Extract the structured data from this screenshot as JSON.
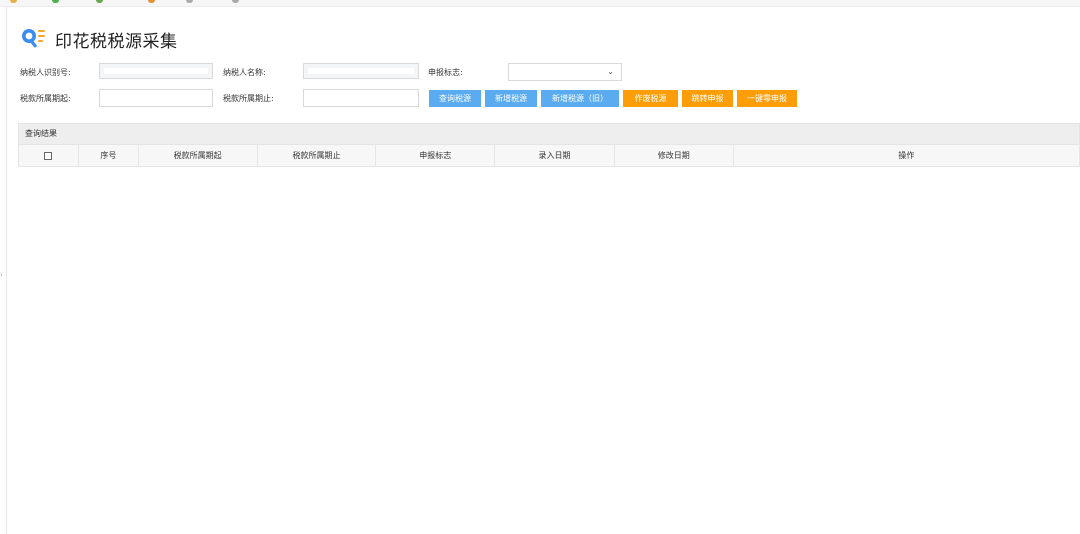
{
  "page": {
    "title": "印花税税源采集",
    "logo_icon": "search-list-icon",
    "colors": {
      "primary_blue": "#5aabf0",
      "accent_orange": "#fd9e09"
    }
  },
  "form": {
    "taxpayer_id": {
      "label": "纳税人识别号:",
      "value": ""
    },
    "taxpayer_name": {
      "label": "纳税人名称:",
      "value": ""
    },
    "declare_flag": {
      "label": "申报标志:",
      "selected": ""
    },
    "period_start": {
      "label": "税款所属期起:",
      "value": ""
    },
    "period_end": {
      "label": "税款所属期止:",
      "value": ""
    }
  },
  "buttons": {
    "query": "查询税源",
    "add": "新增税源",
    "add_old": "新增税源（旧）",
    "void": "作废税源",
    "jump_declare": "跳转申报",
    "one_click_zero": "一键零申报"
  },
  "results": {
    "title": "查询结果",
    "columns": [
      "序号",
      "税款所属期起",
      "税款所属期止",
      "申报标志",
      "录入日期",
      "修改日期",
      "操作"
    ],
    "rows": []
  }
}
